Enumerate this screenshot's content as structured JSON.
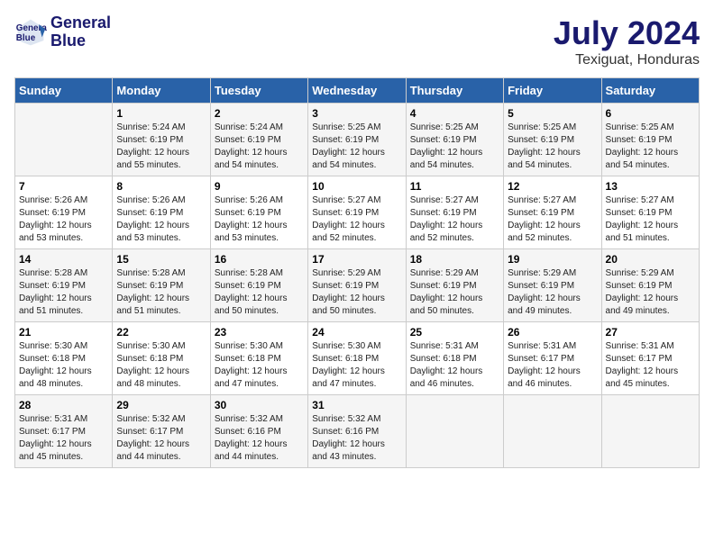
{
  "header": {
    "logo_line1": "General",
    "logo_line2": "Blue",
    "month": "July 2024",
    "location": "Texiguat, Honduras"
  },
  "weekdays": [
    "Sunday",
    "Monday",
    "Tuesday",
    "Wednesday",
    "Thursday",
    "Friday",
    "Saturday"
  ],
  "weeks": [
    [
      {
        "day": "",
        "sunrise": "",
        "sunset": "",
        "daylight": ""
      },
      {
        "day": "1",
        "sunrise": "Sunrise: 5:24 AM",
        "sunset": "Sunset: 6:19 PM",
        "daylight": "Daylight: 12 hours and 55 minutes."
      },
      {
        "day": "2",
        "sunrise": "Sunrise: 5:24 AM",
        "sunset": "Sunset: 6:19 PM",
        "daylight": "Daylight: 12 hours and 54 minutes."
      },
      {
        "day": "3",
        "sunrise": "Sunrise: 5:25 AM",
        "sunset": "Sunset: 6:19 PM",
        "daylight": "Daylight: 12 hours and 54 minutes."
      },
      {
        "day": "4",
        "sunrise": "Sunrise: 5:25 AM",
        "sunset": "Sunset: 6:19 PM",
        "daylight": "Daylight: 12 hours and 54 minutes."
      },
      {
        "day": "5",
        "sunrise": "Sunrise: 5:25 AM",
        "sunset": "Sunset: 6:19 PM",
        "daylight": "Daylight: 12 hours and 54 minutes."
      },
      {
        "day": "6",
        "sunrise": "Sunrise: 5:25 AM",
        "sunset": "Sunset: 6:19 PM",
        "daylight": "Daylight: 12 hours and 54 minutes."
      }
    ],
    [
      {
        "day": "7",
        "sunrise": "Sunrise: 5:26 AM",
        "sunset": "Sunset: 6:19 PM",
        "daylight": "Daylight: 12 hours and 53 minutes."
      },
      {
        "day": "8",
        "sunrise": "Sunrise: 5:26 AM",
        "sunset": "Sunset: 6:19 PM",
        "daylight": "Daylight: 12 hours and 53 minutes."
      },
      {
        "day": "9",
        "sunrise": "Sunrise: 5:26 AM",
        "sunset": "Sunset: 6:19 PM",
        "daylight": "Daylight: 12 hours and 53 minutes."
      },
      {
        "day": "10",
        "sunrise": "Sunrise: 5:27 AM",
        "sunset": "Sunset: 6:19 PM",
        "daylight": "Daylight: 12 hours and 52 minutes."
      },
      {
        "day": "11",
        "sunrise": "Sunrise: 5:27 AM",
        "sunset": "Sunset: 6:19 PM",
        "daylight": "Daylight: 12 hours and 52 minutes."
      },
      {
        "day": "12",
        "sunrise": "Sunrise: 5:27 AM",
        "sunset": "Sunset: 6:19 PM",
        "daylight": "Daylight: 12 hours and 52 minutes."
      },
      {
        "day": "13",
        "sunrise": "Sunrise: 5:27 AM",
        "sunset": "Sunset: 6:19 PM",
        "daylight": "Daylight: 12 hours and 51 minutes."
      }
    ],
    [
      {
        "day": "14",
        "sunrise": "Sunrise: 5:28 AM",
        "sunset": "Sunset: 6:19 PM",
        "daylight": "Daylight: 12 hours and 51 minutes."
      },
      {
        "day": "15",
        "sunrise": "Sunrise: 5:28 AM",
        "sunset": "Sunset: 6:19 PM",
        "daylight": "Daylight: 12 hours and 51 minutes."
      },
      {
        "day": "16",
        "sunrise": "Sunrise: 5:28 AM",
        "sunset": "Sunset: 6:19 PM",
        "daylight": "Daylight: 12 hours and 50 minutes."
      },
      {
        "day": "17",
        "sunrise": "Sunrise: 5:29 AM",
        "sunset": "Sunset: 6:19 PM",
        "daylight": "Daylight: 12 hours and 50 minutes."
      },
      {
        "day": "18",
        "sunrise": "Sunrise: 5:29 AM",
        "sunset": "Sunset: 6:19 PM",
        "daylight": "Daylight: 12 hours and 50 minutes."
      },
      {
        "day": "19",
        "sunrise": "Sunrise: 5:29 AM",
        "sunset": "Sunset: 6:19 PM",
        "daylight": "Daylight: 12 hours and 49 minutes."
      },
      {
        "day": "20",
        "sunrise": "Sunrise: 5:29 AM",
        "sunset": "Sunset: 6:19 PM",
        "daylight": "Daylight: 12 hours and 49 minutes."
      }
    ],
    [
      {
        "day": "21",
        "sunrise": "Sunrise: 5:30 AM",
        "sunset": "Sunset: 6:18 PM",
        "daylight": "Daylight: 12 hours and 48 minutes."
      },
      {
        "day": "22",
        "sunrise": "Sunrise: 5:30 AM",
        "sunset": "Sunset: 6:18 PM",
        "daylight": "Daylight: 12 hours and 48 minutes."
      },
      {
        "day": "23",
        "sunrise": "Sunrise: 5:30 AM",
        "sunset": "Sunset: 6:18 PM",
        "daylight": "Daylight: 12 hours and 47 minutes."
      },
      {
        "day": "24",
        "sunrise": "Sunrise: 5:30 AM",
        "sunset": "Sunset: 6:18 PM",
        "daylight": "Daylight: 12 hours and 47 minutes."
      },
      {
        "day": "25",
        "sunrise": "Sunrise: 5:31 AM",
        "sunset": "Sunset: 6:18 PM",
        "daylight": "Daylight: 12 hours and 46 minutes."
      },
      {
        "day": "26",
        "sunrise": "Sunrise: 5:31 AM",
        "sunset": "Sunset: 6:17 PM",
        "daylight": "Daylight: 12 hours and 46 minutes."
      },
      {
        "day": "27",
        "sunrise": "Sunrise: 5:31 AM",
        "sunset": "Sunset: 6:17 PM",
        "daylight": "Daylight: 12 hours and 45 minutes."
      }
    ],
    [
      {
        "day": "28",
        "sunrise": "Sunrise: 5:31 AM",
        "sunset": "Sunset: 6:17 PM",
        "daylight": "Daylight: 12 hours and 45 minutes."
      },
      {
        "day": "29",
        "sunrise": "Sunrise: 5:32 AM",
        "sunset": "Sunset: 6:17 PM",
        "daylight": "Daylight: 12 hours and 44 minutes."
      },
      {
        "day": "30",
        "sunrise": "Sunrise: 5:32 AM",
        "sunset": "Sunset: 6:16 PM",
        "daylight": "Daylight: 12 hours and 44 minutes."
      },
      {
        "day": "31",
        "sunrise": "Sunrise: 5:32 AM",
        "sunset": "Sunset: 6:16 PM",
        "daylight": "Daylight: 12 hours and 43 minutes."
      },
      {
        "day": "",
        "sunrise": "",
        "sunset": "",
        "daylight": ""
      },
      {
        "day": "",
        "sunrise": "",
        "sunset": "",
        "daylight": ""
      },
      {
        "day": "",
        "sunrise": "",
        "sunset": "",
        "daylight": ""
      }
    ]
  ]
}
